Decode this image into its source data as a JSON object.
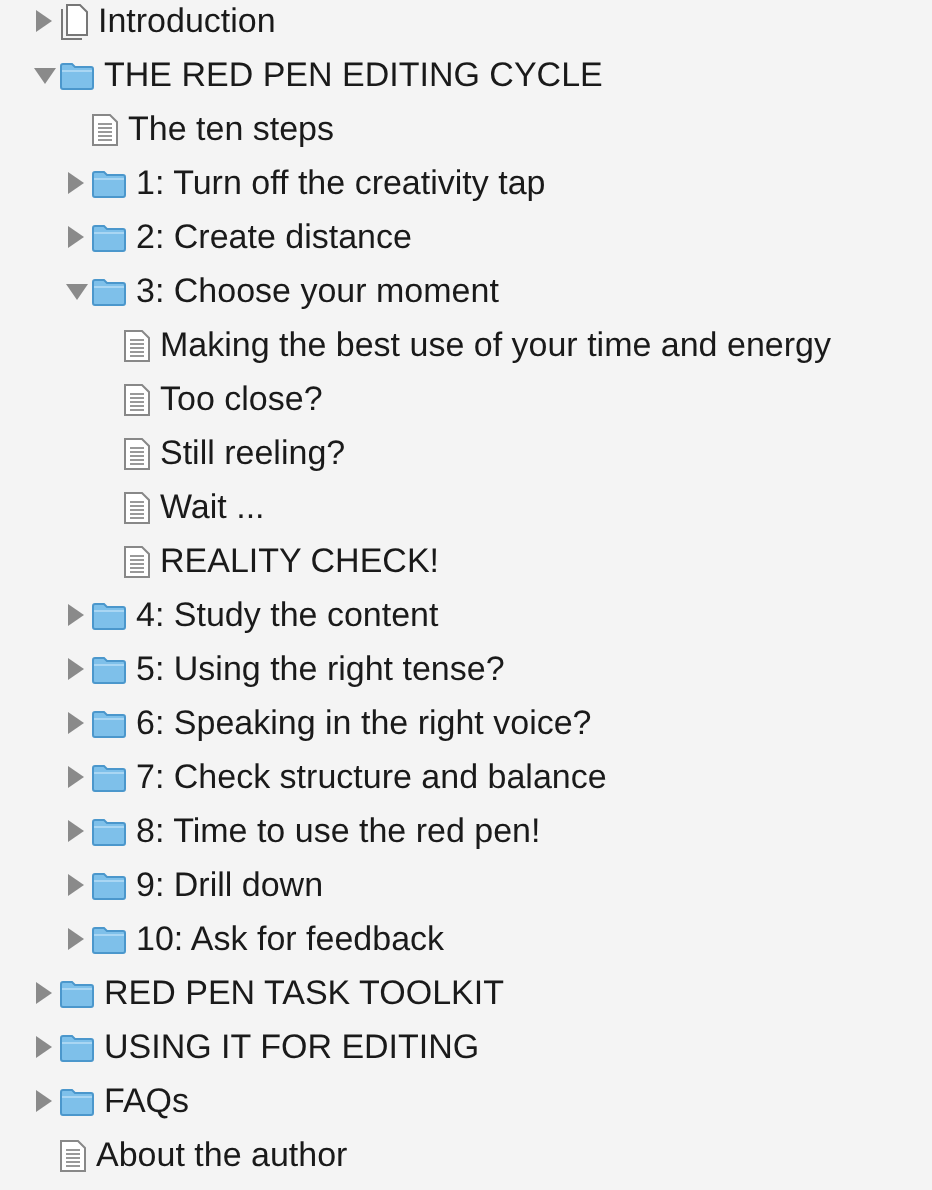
{
  "binder": [
    {
      "title": "Introduction",
      "kind": "blank",
      "expanded": false
    },
    {
      "title": "THE RED PEN EDITING CYCLE",
      "kind": "folder",
      "expanded": true,
      "children": [
        {
          "title": "The ten steps",
          "kind": "text"
        },
        {
          "title": "1: Turn off the creativity tap",
          "kind": "folder",
          "expanded": false
        },
        {
          "title": "2: Create distance",
          "kind": "folder",
          "expanded": false
        },
        {
          "title": "3: Choose your moment",
          "kind": "folder",
          "expanded": true,
          "children": [
            {
              "title": "Making the best use of your time and energy",
              "kind": "text"
            },
            {
              "title": "Too close?",
              "kind": "text"
            },
            {
              "title": "Still reeling?",
              "kind": "text"
            },
            {
              "title": "Wait ...",
              "kind": "text"
            },
            {
              "title": "REALITY CHECK!",
              "kind": "text"
            }
          ]
        },
        {
          "title": "4: Study the content",
          "kind": "folder",
          "expanded": false
        },
        {
          "title": "5: Using the right tense?",
          "kind": "folder",
          "expanded": false
        },
        {
          "title": "6: Speaking in the right voice?",
          "kind": "folder",
          "expanded": false
        },
        {
          "title": "7: Check structure and balance",
          "kind": "folder",
          "expanded": false
        },
        {
          "title": "8: Time to use the red pen!",
          "kind": "folder",
          "expanded": false
        },
        {
          "title": "9: Drill down",
          "kind": "folder",
          "expanded": false
        },
        {
          "title": "10: Ask for feedback",
          "kind": "folder",
          "expanded": false
        }
      ]
    },
    {
      "title": "RED PEN TASK TOOLKIT",
      "kind": "folder",
      "expanded": false
    },
    {
      "title": "USING IT FOR EDITING",
      "kind": "folder",
      "expanded": false
    },
    {
      "title": "FAQs",
      "kind": "folder",
      "expanded": false
    },
    {
      "title": "About the author",
      "kind": "text"
    }
  ]
}
